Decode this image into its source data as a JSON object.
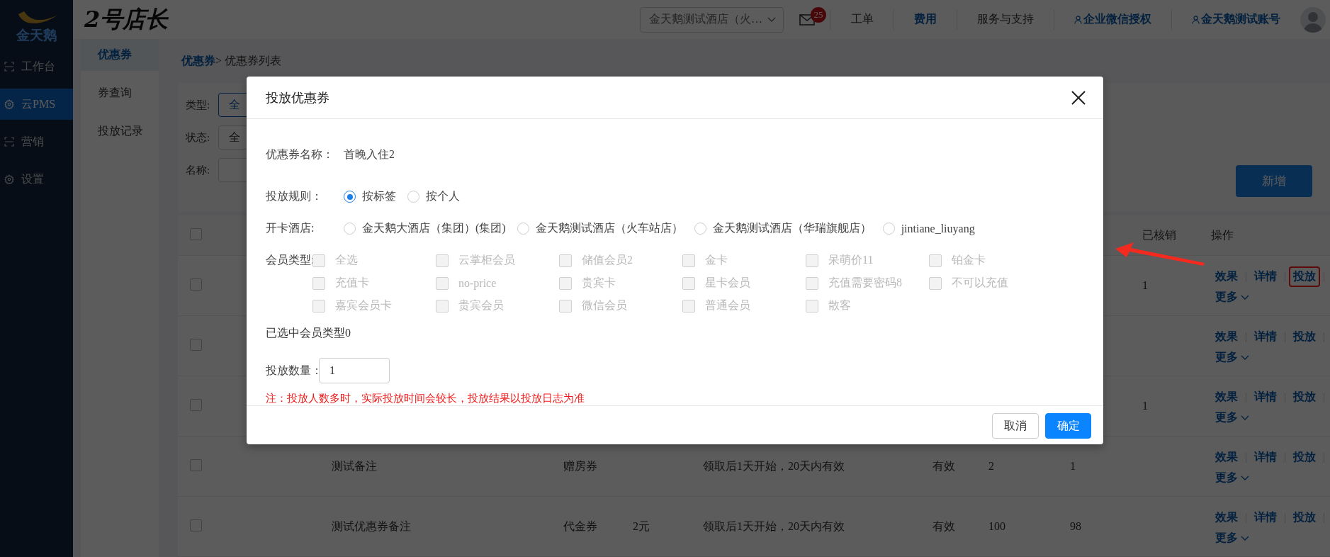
{
  "sidebar": {
    "logo_text": "金天鹅",
    "items": [
      {
        "label": "工作台",
        "kind": "scan",
        "selected": false
      },
      {
        "label": "云PMS",
        "kind": "gear",
        "selected": true
      },
      {
        "label": "营销",
        "kind": "scan",
        "selected": false
      },
      {
        "label": "设置",
        "kind": "gear",
        "selected": false
      }
    ]
  },
  "header": {
    "brand": "2号店长",
    "hotel_select": {
      "value": "金天鹅测试酒店（火…"
    },
    "mail_badge": "25",
    "links": [
      {
        "label": "工单",
        "kind": "plain"
      },
      {
        "label": "费用",
        "kind": "link"
      },
      {
        "label": "服务与支持",
        "kind": "plain"
      },
      {
        "label": "企业微信授权",
        "kind": "user"
      },
      {
        "label": "金天鹅测试账号",
        "kind": "user"
      }
    ]
  },
  "subnav": [
    {
      "label": "优惠券",
      "selected": true
    },
    {
      "label": "券查询",
      "selected": false
    },
    {
      "label": "投放记录",
      "selected": false
    }
  ],
  "breadcrumb": {
    "parent": "优惠券",
    "current": "> 优惠券列表"
  },
  "filters": [
    {
      "kind": "buttons",
      "label": "类型:",
      "options": [
        {
          "label": "全",
          "selected": true
        }
      ]
    },
    {
      "kind": "buttons",
      "label": "状态:",
      "options": [
        {
          "label": "全",
          "selected": false
        }
      ]
    },
    {
      "kind": "input",
      "label": "名称:"
    }
  ],
  "add_button": "新增",
  "table": {
    "header_checked": false,
    "columns": [
      {
        "label": "已核销"
      },
      {
        "label": "操作"
      }
    ],
    "rows": [
      {
        "checked": false,
        "redeemed": "1",
        "actions": [
          {
            "label": "效果",
            "highlighted": false
          },
          {
            "label": "详情",
            "highlighted": false
          },
          {
            "label": "投放",
            "highlighted": true
          }
        ],
        "more": "更多"
      },
      {
        "checked": false,
        "actions": [
          {
            "label": "效果",
            "highlighted": false
          },
          {
            "label": "详情",
            "highlighted": false
          },
          {
            "label": "投放",
            "highlighted": false
          }
        ],
        "more": "更多"
      },
      {
        "checked": false,
        "redeemed": "1",
        "actions": [
          {
            "label": "效果",
            "highlighted": false
          },
          {
            "label": "详情",
            "highlighted": false
          },
          {
            "label": "投放",
            "highlighted": false
          }
        ],
        "more": "更多"
      },
      {
        "checked": false,
        "column_2": "测试备注",
        "column_3": "赠房券",
        "column_5": "领取后1天开始，20天内有效",
        "column_6": "有效",
        "column_7": "2",
        "column_8": "1",
        "actions": [
          {
            "label": "效果",
            "highlighted": false
          },
          {
            "label": "详情",
            "highlighted": false
          },
          {
            "label": "投放",
            "highlighted": false
          }
        ],
        "more": "更多"
      },
      {
        "checked": false,
        "column_2": "测试优惠券备注",
        "column_3": "代金券",
        "column_4": "2元",
        "column_5": "领取后1天开始，20天内有效",
        "column_6": "有效",
        "column_7": "100",
        "column_8": "98",
        "actions": [
          {
            "label": "效果",
            "highlighted": false
          },
          {
            "label": "详情",
            "highlighted": false
          },
          {
            "label": "投放",
            "highlighted": false
          }
        ],
        "more": "更多"
      }
    ]
  },
  "dialog": {
    "title": "投放优惠券",
    "fields": [
      {
        "kind": "text",
        "label": "优惠券名称：",
        "value": "首晚入住2"
      },
      {
        "kind": "radio",
        "label": "投放规则：",
        "options": [
          {
            "label": "按标签",
            "selected": true
          },
          {
            "label": "按个人",
            "selected": false
          }
        ]
      },
      {
        "kind": "radio",
        "label": "开卡酒店:",
        "options": [
          {
            "label": "金天鹅大酒店（集团）(集团)",
            "selected": false
          },
          {
            "label": "金天鹅测试酒店（火车站店）",
            "selected": false
          },
          {
            "label": "金天鹅测试酒店（华瑞旗舰店）",
            "selected": false
          },
          {
            "label": "jintiane_liuyang",
            "selected": false
          }
        ]
      },
      {
        "kind": "checkbox",
        "label": "会员类型:",
        "options": [
          {
            "label": "全选",
            "checked": false,
            "disabled": true
          },
          {
            "label": "云掌柜会员",
            "checked": false,
            "disabled": true
          },
          {
            "label": "储值会员2",
            "checked": false,
            "disabled": true
          },
          {
            "label": "金卡",
            "checked": false,
            "disabled": true
          },
          {
            "label": "呆萌价11",
            "checked": false,
            "disabled": true
          },
          {
            "label": "铂金卡",
            "checked": false,
            "disabled": true
          },
          {
            "label": "充值卡",
            "checked": false,
            "disabled": true
          },
          {
            "label": "no-price",
            "checked": false,
            "disabled": true
          },
          {
            "label": "贵宾卡",
            "checked": false,
            "disabled": true
          },
          {
            "label": "星卡会员",
            "checked": false,
            "disabled": true
          },
          {
            "label": "充值需要密码8",
            "checked": false,
            "disabled": true
          },
          {
            "label": "不可以充值",
            "checked": false,
            "disabled": true
          },
          {
            "label": "嘉宾会员卡",
            "checked": false,
            "disabled": true
          },
          {
            "label": "贵宾会员",
            "checked": false,
            "disabled": true
          },
          {
            "label": "微信会员",
            "checked": false,
            "disabled": true
          },
          {
            "label": "普通会员",
            "checked": false,
            "disabled": true
          },
          {
            "label": "散客",
            "checked": false,
            "disabled": true
          }
        ]
      },
      {
        "kind": "note",
        "text": "已选中会员类型0"
      },
      {
        "kind": "input",
        "label": "投放数量：",
        "value": "1"
      },
      {
        "kind": "warning",
        "text": "注：投放人数多时，实际投放时间会较长，投放结果以投放日志为准"
      }
    ],
    "buttons": [
      {
        "label": "取消",
        "kind": "secondary"
      },
      {
        "label": "确定",
        "kind": "primary"
      }
    ]
  }
}
